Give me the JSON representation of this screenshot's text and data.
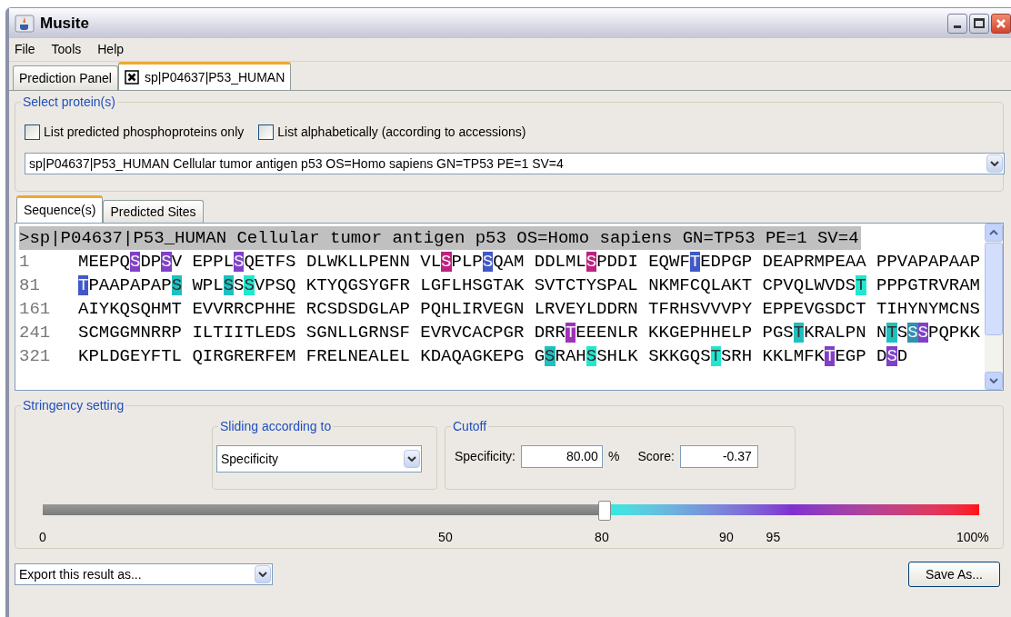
{
  "window": {
    "title": "Musite"
  },
  "menu": [
    "File",
    "Tools",
    "Help"
  ],
  "tabs": [
    {
      "label": "Prediction Panel",
      "selected": false,
      "closable": false
    },
    {
      "label": "sp|P04637|P53_HUMAN",
      "selected": true,
      "closable": true
    }
  ],
  "select_protein": {
    "title": "Select protein(s)",
    "checkboxes": [
      {
        "label": "List predicted phosphoproteins only",
        "checked": false
      },
      {
        "label": "List alphabetically (according to accessions)",
        "checked": false
      }
    ],
    "protein": "sp|P04637|P53_HUMAN Cellular tumor antigen p53 OS=Homo sapiens GN=TP53 PE=1 SV=4"
  },
  "view_tabs": [
    {
      "label": "Sequence(s)",
      "selected": true
    },
    {
      "label": "Predicted Sites",
      "selected": false
    }
  ],
  "sequence": {
    "header": ">sp|P04637|P53_HUMAN Cellular tumor antigen p53 OS=Homo sapiens GN=TP53 PE=1 SV=4",
    "rows": [
      {
        "number": "1",
        "segments": [
          {
            "text": "MEEPQ"
          },
          {
            "text": "S",
            "color": "#8040c8"
          },
          {
            "text": "DP"
          },
          {
            "text": "S",
            "color": "#8040c8"
          },
          {
            "text": "V EPPL"
          },
          {
            "text": "S",
            "color": "#8040c8"
          },
          {
            "text": "QETFS DLWKLLPENN VL"
          },
          {
            "text": "S",
            "color": "#c02080"
          },
          {
            "text": "PLP"
          },
          {
            "text": "S",
            "color": "#4058c8"
          },
          {
            "text": "QAM DDLML"
          },
          {
            "text": "S",
            "color": "#c02080"
          },
          {
            "text": "PDDI EQWF"
          },
          {
            "text": "T",
            "color": "#4058c8"
          },
          {
            "text": "EDPGP DEAPRMPEAA PPVAPAPAAP"
          }
        ]
      },
      {
        "number": "81",
        "segments": [
          {
            "text": "T",
            "color": "#4058c8"
          },
          {
            "text": "PAAPAPAP"
          },
          {
            "text": "S",
            "color": "#20c0c0"
          },
          {
            "text": " WPL"
          },
          {
            "text": "S",
            "color": "#20c0c0"
          },
          {
            "text": "S"
          },
          {
            "text": "S",
            "color": "#20e8d0"
          },
          {
            "text": "VPSQ KTYQGSYGFR LGFLHSGTAK SVTCTYSPAL NKMFCQLAKT CPVQLWVDS"
          },
          {
            "text": "T",
            "color": "#20e8d0"
          },
          {
            "text": " PPPGTRVRAM"
          }
        ]
      },
      {
        "number": "161",
        "segments": [
          {
            "text": "AIYKQSQHMT EVVRRCPHHE RCSDSDGLAP PQHLIRVEGN LRVEYLDDRN TFRHSVVVPY EPPEVGSDCT TIHYNYMCNS"
          }
        ]
      },
      {
        "number": "241",
        "segments": [
          {
            "text": "SCMGGMNRRP ILTIITLEDS SGNLLGRNSF EVRVCACPGR DRR"
          },
          {
            "text": "T",
            "color": "#a030b8"
          },
          {
            "text": "EEENLR KKGEPHHELP PGS"
          },
          {
            "text": "T",
            "color": "#20c0c0"
          },
          {
            "text": "KRALPN N"
          },
          {
            "text": "T",
            "color": "#20c0c0"
          },
          {
            "text": "S"
          },
          {
            "text": "S",
            "color": "#3090b0"
          },
          {
            "text": "S",
            "color": "#8040c8"
          },
          {
            "text": "PQPKK"
          }
        ]
      },
      {
        "number": "321",
        "segments": [
          {
            "text": "KPLDGEYFTL QIRGRERFEM FRELNEALEL KDAQAGKEPG G"
          },
          {
            "text": "S",
            "color": "#20c0c0"
          },
          {
            "text": "RAH"
          },
          {
            "text": "S",
            "color": "#20e8d0"
          },
          {
            "text": "SHLK SKKGQS"
          },
          {
            "text": "T",
            "color": "#20e8d0"
          },
          {
            "text": "SRH KKLMFK"
          },
          {
            "text": "T",
            "color": "#8040c8"
          },
          {
            "text": "EGP D"
          },
          {
            "text": "S",
            "color": "#8040c8"
          },
          {
            "text": "D"
          }
        ]
      }
    ]
  },
  "stringency": {
    "title": "Stringency setting",
    "sliding": {
      "title": "Sliding according to",
      "value": "Specificity"
    },
    "cutoff": {
      "title": "Cutoff",
      "specificity_label": "Specificity:",
      "specificity": "80.00",
      "unit": "%",
      "score_label": "Score:",
      "score": "-0.37"
    },
    "slider": {
      "level": 0.6,
      "ticks": [
        "0",
        "50",
        "80",
        "90",
        "95",
        "100%"
      ]
    }
  },
  "export": {
    "value": "Export this result as..."
  },
  "save_button": "Save As..."
}
